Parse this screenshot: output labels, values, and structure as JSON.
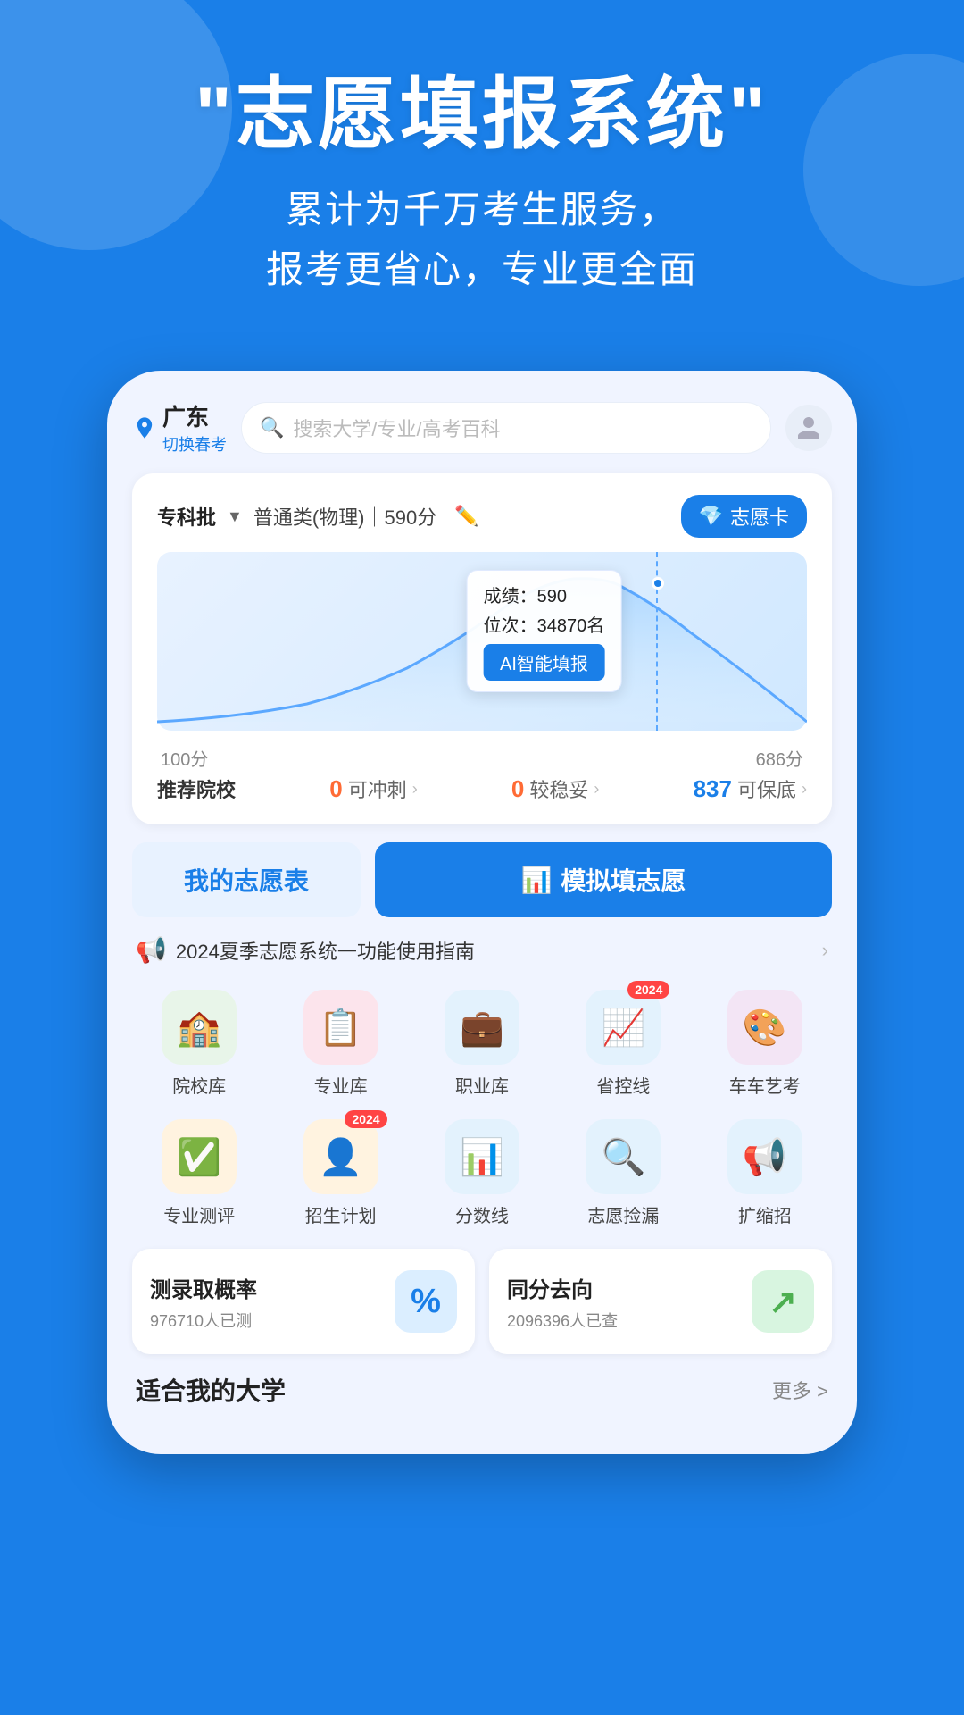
{
  "hero": {
    "title": "\"志愿填报系统\"",
    "subtitle_line1": "累计为千万考生服务，",
    "subtitle_line2": "报考更省心，专业更全面"
  },
  "phone": {
    "location": {
      "name": "广东",
      "switch_label": "切换春考"
    },
    "search": {
      "placeholder": "搜索大学/专业/高考百科"
    },
    "score_card": {
      "batch": "专科批",
      "category": "普通类(物理)｜590分",
      "zhiyuan_card": "志愿卡",
      "chart": {
        "score_label": "成绩：590",
        "rank_label": "位次：34870名",
        "ai_btn": "AI智能填报",
        "min_score": "100分",
        "max_score": "686分"
      },
      "recommended": {
        "label": "推荐院校",
        "chong": {
          "count": "0",
          "type": "可冲刺"
        },
        "wen": {
          "count": "0",
          "type": "较稳妥"
        },
        "bao": {
          "count": "837",
          "type": "可保底"
        }
      }
    },
    "action_btns": {
      "my_zhi": "我的志愿表",
      "moni": "模拟填志愿"
    },
    "notice": {
      "text": "2024夏季志愿系统一功能使用指南"
    },
    "features": [
      {
        "label": "院校库",
        "color": "#4caf50",
        "bg": "#e8f5e9",
        "icon": "🏫"
      },
      {
        "label": "专业库",
        "color": "#e53935",
        "bg": "#fce4ec",
        "icon": "📋"
      },
      {
        "label": "职业库",
        "color": "#1a7fe8",
        "bg": "#e3f2fd",
        "icon": "💼"
      },
      {
        "label": "省控线",
        "color": "#1a7fe8",
        "bg": "#e3f2fd",
        "icon": "📈",
        "badge": "2024"
      },
      {
        "label": "车车艺考",
        "color": "#9c27b0",
        "bg": "#f3e5f5",
        "icon": "🎨"
      },
      {
        "label": "专业测评",
        "color": "#ff9800",
        "bg": "#fff3e0",
        "icon": "✅"
      },
      {
        "label": "招生计划",
        "color": "#ff9800",
        "bg": "#fff3e0",
        "icon": "👤",
        "badge": "2024"
      },
      {
        "label": "分数线",
        "color": "#1a7fe8",
        "bg": "#e3f2fd",
        "icon": "📊"
      },
      {
        "label": "志愿捡漏",
        "color": "#1a7fe8",
        "bg": "#e3f2fd",
        "icon": "🔍"
      },
      {
        "label": "扩缩招",
        "color": "#1a7fe8",
        "bg": "#e3f2fd",
        "icon": "📢"
      }
    ],
    "bottom_cards": [
      {
        "title": "测录取概率",
        "subtitle": "976710人已测",
        "icon": "％",
        "icon_bg": "#e3f2fd",
        "icon_color": "#1a7fe8"
      },
      {
        "title": "同分去向",
        "subtitle": "2096396人已查",
        "icon": "↗",
        "icon_bg": "#e8f5e9",
        "icon_color": "#4caf50"
      }
    ],
    "suitable_section": {
      "title": "适合我的大学",
      "more": "更多 >"
    }
  }
}
